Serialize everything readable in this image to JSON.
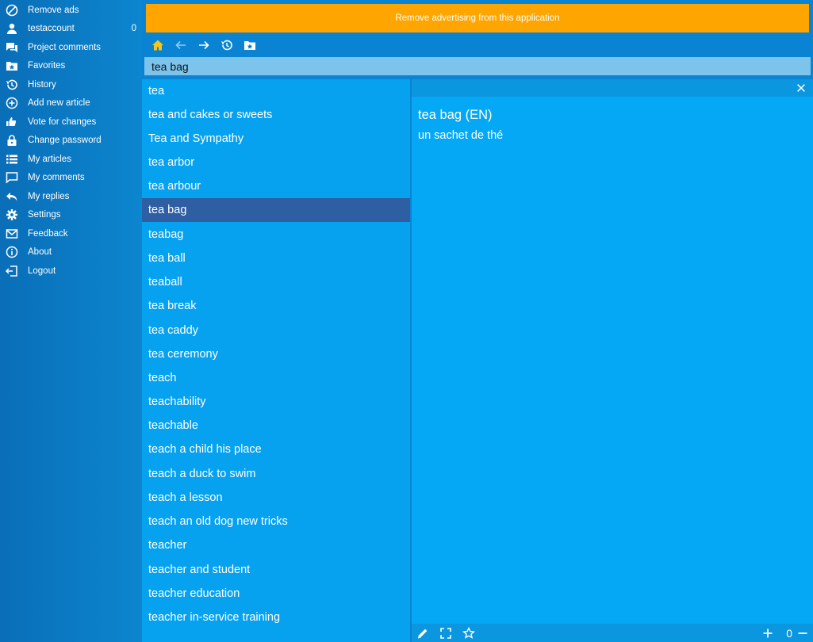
{
  "sidebar": {
    "items": [
      {
        "icon": "block-icon",
        "label": "Remove ads"
      },
      {
        "icon": "person-icon",
        "label": "testaccount",
        "count": "0"
      },
      {
        "icon": "comments-icon",
        "label": "Project comments"
      },
      {
        "icon": "favorites-folder-icon",
        "label": "Favorites"
      },
      {
        "icon": "history-icon",
        "label": "History"
      },
      {
        "icon": "add-circle-icon",
        "label": "Add new article"
      },
      {
        "icon": "thumbs-icon",
        "label": "Vote for changes"
      },
      {
        "icon": "lock-icon",
        "label": "Change password"
      },
      {
        "icon": "list-icon",
        "label": "My articles"
      },
      {
        "icon": "comment-icon",
        "label": "My comments"
      },
      {
        "icon": "reply-icon",
        "label": "My replies"
      },
      {
        "icon": "gear-icon",
        "label": "Settings"
      },
      {
        "icon": "mail-icon",
        "label": "Feedback"
      },
      {
        "icon": "info-icon",
        "label": "About"
      },
      {
        "icon": "logout-icon",
        "label": "Logout"
      }
    ]
  },
  "ad_banner": {
    "label": "Remove advertising from this application",
    "color": "#ffa500"
  },
  "search": {
    "value": "tea bag"
  },
  "wordlist": {
    "selected_index": 5,
    "items": [
      "tea",
      "tea and cakes or sweets",
      "Tea and Sympathy",
      "tea arbor",
      "tea arbour",
      "tea bag",
      "teabag",
      "tea ball",
      "teaball",
      "tea break",
      "tea caddy",
      "tea ceremony",
      "teach",
      "teachability",
      "teachable",
      "teach a child his place",
      "teach a duck to swim",
      "teach a lesson",
      "teach an old dog new tricks",
      "teacher",
      "teacher and student",
      "teacher education",
      "teacher in-service training"
    ]
  },
  "article": {
    "title": "tea bag (EN)",
    "translation": "un sachet de thé",
    "zoom": "0"
  },
  "colors": {
    "accent": "#05a8f5",
    "selected": "#2e5fa3",
    "home_icon": "#f5c518"
  }
}
